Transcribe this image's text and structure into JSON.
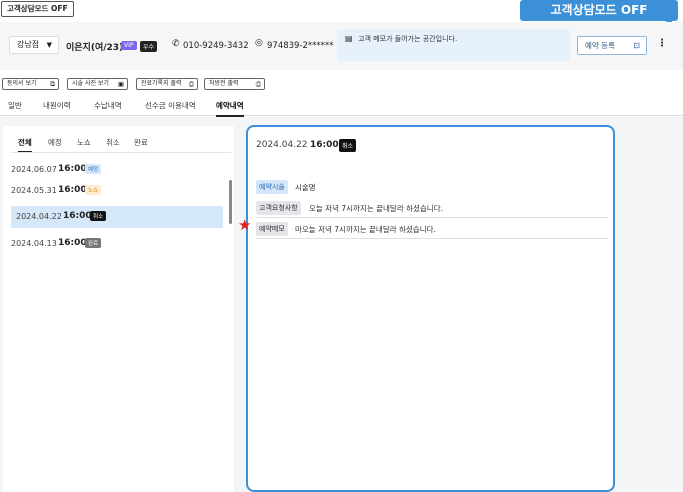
{
  "top": {
    "mode_button": "고객상담모드 OFF",
    "mode_banner": "고객상담모드 OFF"
  },
  "header": {
    "branch": "강남점",
    "customer_name": "이은지(여/23)",
    "badge_vip": "VIP",
    "badge_grade": "우수",
    "phone": "010-9249-3432",
    "id_number": "974839-2******",
    "memo_placeholder": "고객 메모가 들어가는 공간입니다.",
    "reserve_button": "예약 등록"
  },
  "toolbar": [
    {
      "label": "동의서 보기"
    },
    {
      "label": "시술 사진 보기"
    },
    {
      "label": "진료기록지 출력"
    },
    {
      "label": "처방전 출력"
    }
  ],
  "main_tabs": [
    "일반",
    "내원이력",
    "수납내역",
    "선수금 이용내역",
    "예약내역"
  ],
  "main_tab_active": "예약내역",
  "sub_tabs": [
    "전체",
    "예정",
    "노쇼",
    "취소",
    "완료"
  ],
  "sub_tab_active": "전체",
  "reservations": [
    {
      "date": "2024.06.07",
      "time": "16:00",
      "status": "예정"
    },
    {
      "date": "2024.05.31",
      "time": "16:00",
      "status": "노쇼"
    },
    {
      "date": "2024.04.22",
      "time": "16:00",
      "status": "취소"
    },
    {
      "date": "2024.04.13",
      "time": "16:00",
      "status": "완료"
    }
  ],
  "detail": {
    "date": "2024.04.22",
    "time": "16:00",
    "status": "취소",
    "rows": [
      {
        "label": "예약시술",
        "value": "시술명"
      },
      {
        "label": "고객요청사항",
        "value": "오늘 저녁 7시까지는 끝내달라 하셨습니다."
      },
      {
        "label": "예약메모",
        "value": "마오늘 저녁 7시까지는 끝내달라 하셨습니다."
      }
    ]
  },
  "colors": {
    "accent": "#3b90d8",
    "selected_row": "#d5e8f9",
    "marker": "#e02020"
  },
  "icons": [
    "caret-down-icon",
    "phone-icon",
    "id-card-icon",
    "memo-icon",
    "calendar-icon",
    "more-icon",
    "doc-icon",
    "photo-icon",
    "print-icon",
    "star-icon"
  ]
}
